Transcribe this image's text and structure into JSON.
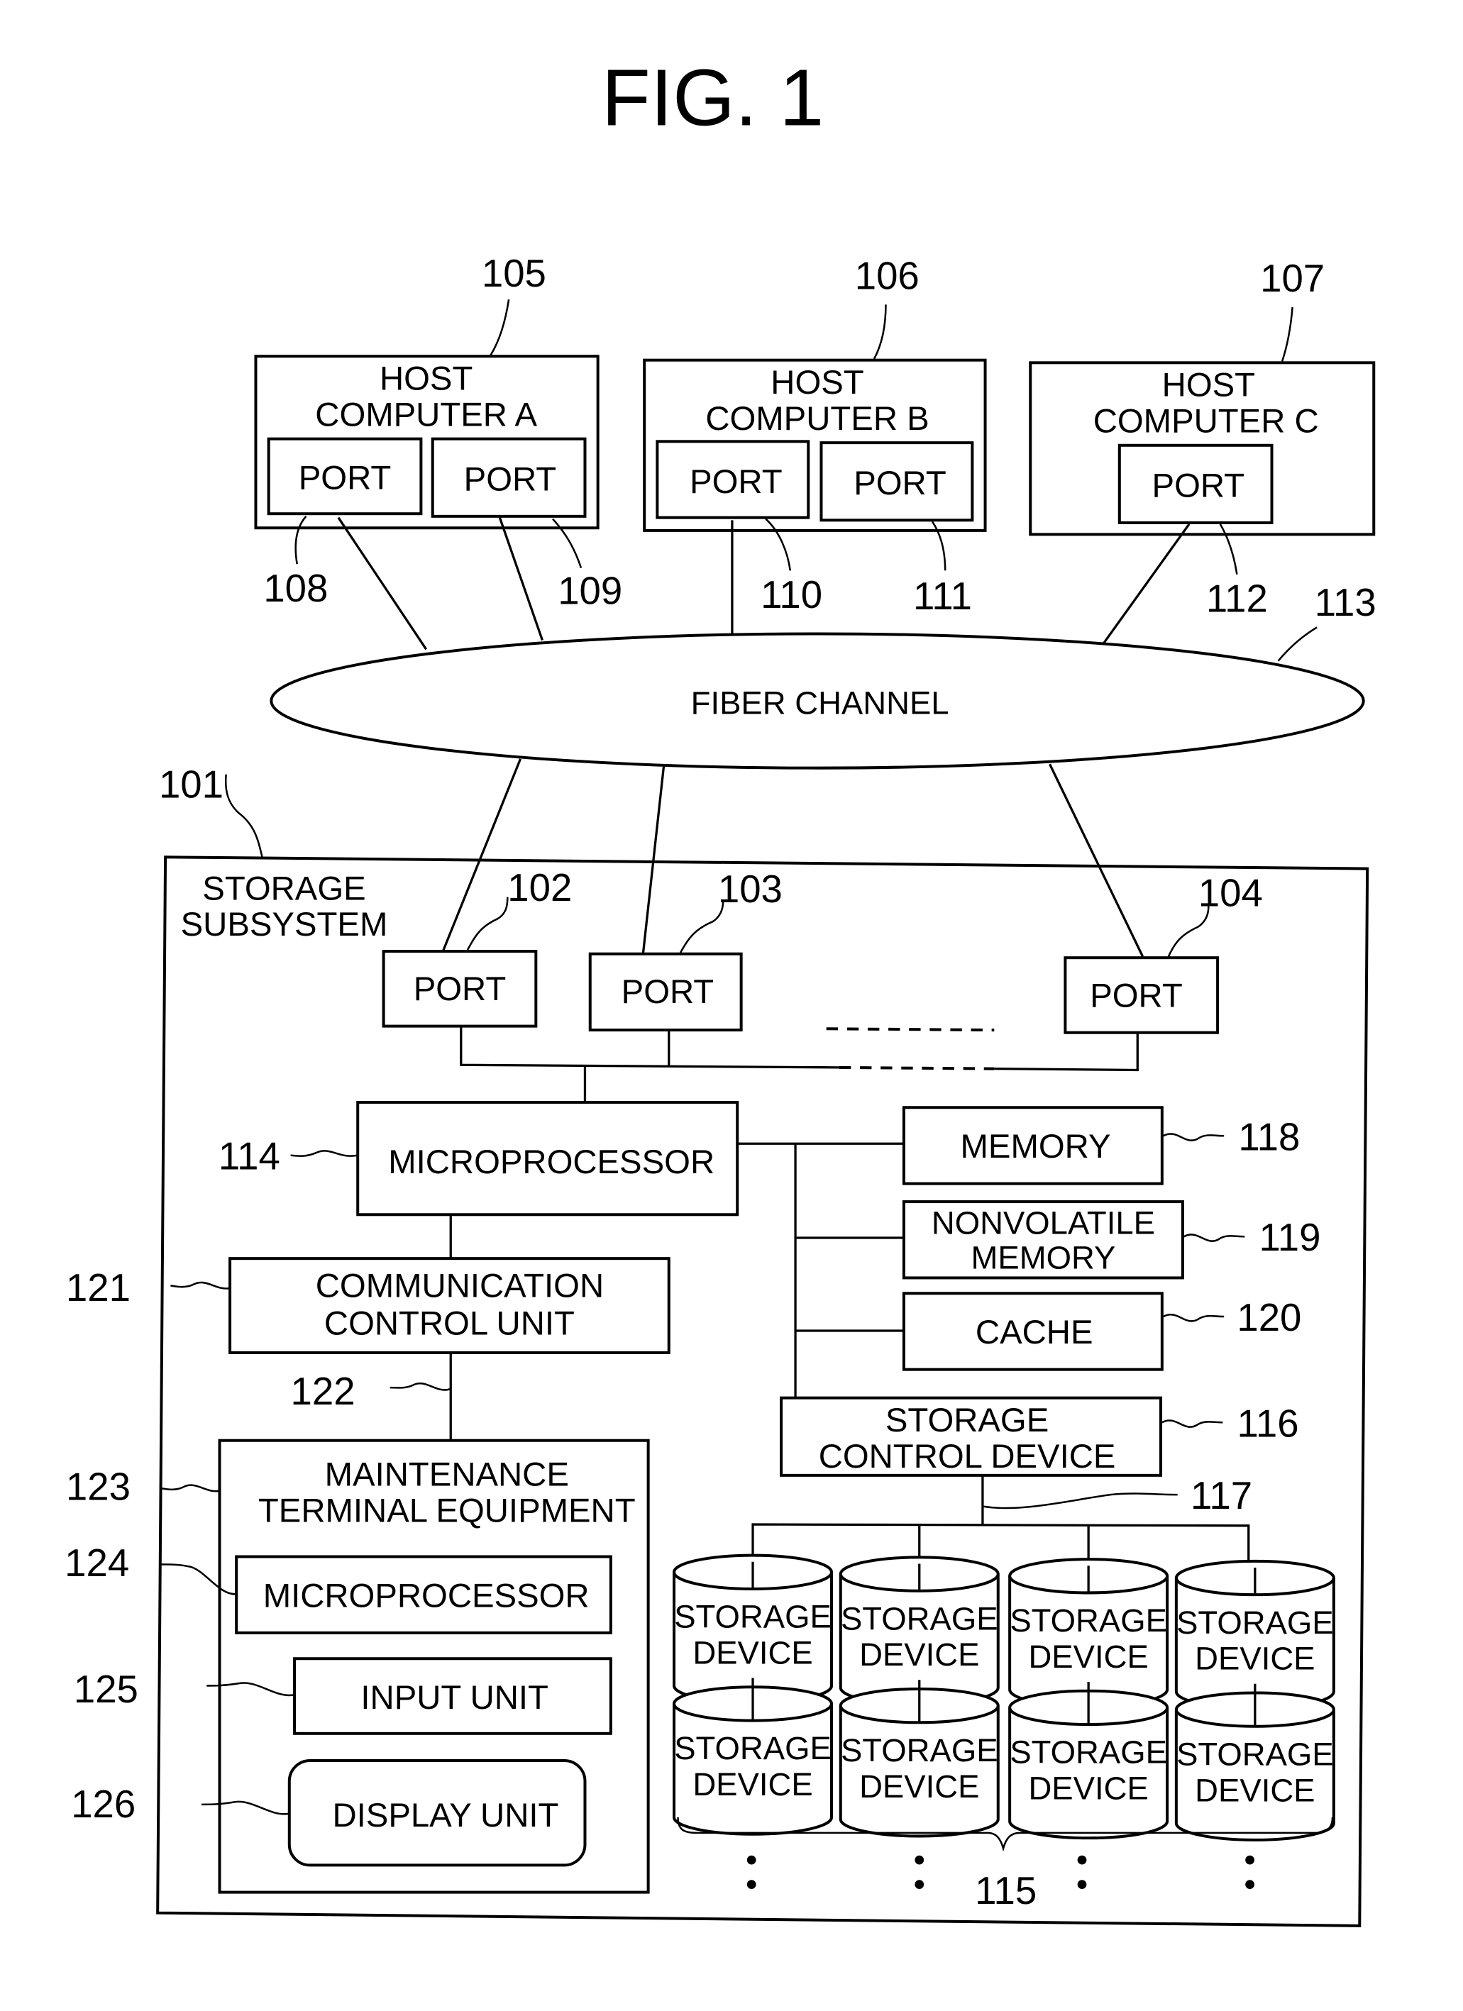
{
  "figure": {
    "title": "FIG. 1"
  },
  "hosts": [
    {
      "ref": "105",
      "line1": "HOST",
      "line2": "COMPUTER  A",
      "ports": [
        {
          "label": "PORT",
          "ref": "108"
        },
        {
          "label": "PORT",
          "ref": "109"
        }
      ]
    },
    {
      "ref": "106",
      "line1": "HOST",
      "line2": "COMPUTER  B",
      "ports": [
        {
          "label": "PORT",
          "ref": "110"
        },
        {
          "label": "PORT",
          "ref": "111"
        }
      ]
    },
    {
      "ref": "107",
      "line1": "HOST",
      "line2": "COMPUTER  C",
      "ports": [
        {
          "label": "PORT",
          "ref": "112"
        }
      ]
    }
  ],
  "network": {
    "label": "FIBER  CHANNEL",
    "ref": "113"
  },
  "storage_subsystem": {
    "ref": "101",
    "line1": "STORAGE",
    "line2": "SUBSYSTEM",
    "ports": [
      {
        "label": "PORT",
        "ref": "102"
      },
      {
        "label": "PORT",
        "ref": "103"
      },
      {
        "label": "PORT",
        "ref": "104"
      }
    ],
    "microprocessor": {
      "label": "MICROPROCESSOR",
      "ref": "114"
    },
    "memory": {
      "label": "MEMORY",
      "ref": "118"
    },
    "nonvolatile_memory": {
      "line1": "NONVOLATILE",
      "line2": "MEMORY",
      "ref": "119"
    },
    "cache": {
      "label": "CACHE",
      "ref": "120"
    },
    "storage_control_device": {
      "line1": "STORAGE",
      "line2": "CONTROL  DEVICE",
      "ref": "116",
      "bus_ref": "117"
    },
    "communication_control_unit": {
      "line1": "COMMUNICATION",
      "line2": "CONTROL  UNIT",
      "ref": "121",
      "link_ref": "122"
    },
    "maintenance_terminal": {
      "line1": "MAINTENANCE",
      "line2": "TERMINAL  EQUIPMENT",
      "ref": "123",
      "microprocessor": {
        "label": "MICROPROCESSOR",
        "ref": "124"
      },
      "input_unit": {
        "label": "INPUT  UNIT",
        "ref": "125"
      },
      "display_unit": {
        "label": "DISPLAY  UNIT",
        "ref": "126"
      }
    },
    "storage_devices": {
      "ref": "115",
      "line1": "STORAGE",
      "line2": "DEVICE",
      "rows": 2,
      "columns": 4
    }
  }
}
